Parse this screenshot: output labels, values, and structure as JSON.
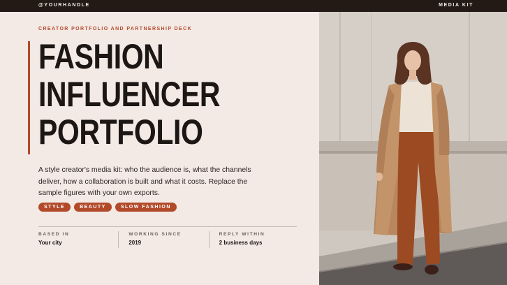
{
  "topbar": {
    "handle": "@YOURHANDLE",
    "label": "MEDIA KIT"
  },
  "hero": {
    "kicker": "CREATOR PORTFOLIO AND PARTNERSHIP DECK",
    "title_lines": [
      "FASHION",
      "INFLUENCER",
      "PORTFOLIO"
    ],
    "description": "A style creator's media kit: who the audience is, what the channels deliver, how a collaboration is built and what it costs. Replace the sample figures with your own exports."
  },
  "tags": [
    "STYLE",
    "BEAUTY",
    "SLOW FASHION"
  ],
  "facts": [
    {
      "label": "BASED IN",
      "value": "Your city"
    },
    {
      "label": "WORKING SINCE",
      "value": "2019"
    },
    {
      "label": "REPLY WITHIN",
      "value": "2 business days"
    }
  ],
  "colors": {
    "accent": "#b24a2a",
    "topbar": "#231a15",
    "background": "#f3e9e5"
  }
}
